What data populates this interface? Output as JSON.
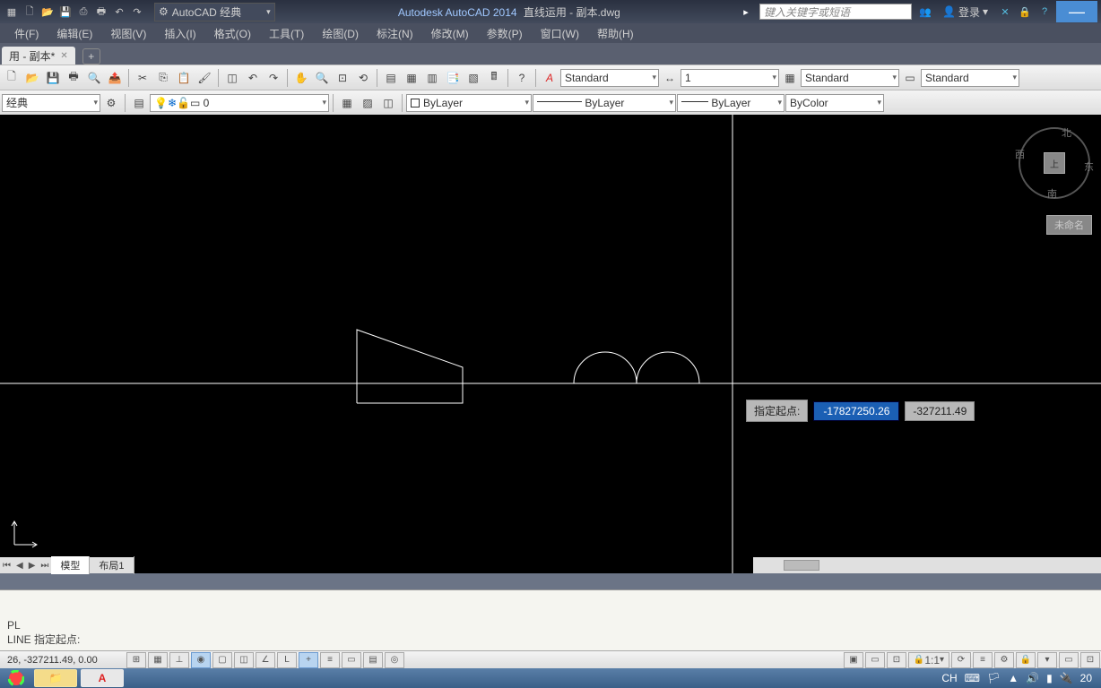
{
  "titlebar": {
    "workspace": "AutoCAD 经典",
    "app": "Autodesk AutoCAD 2014",
    "doc": "直线运用 - 副本.dwg",
    "search_placeholder": "键入关键字或短语",
    "login": "登录"
  },
  "menu": [
    "件(F)",
    "编辑(E)",
    "视图(V)",
    "插入(I)",
    "格式(O)",
    "工具(T)",
    "绘图(D)",
    "标注(N)",
    "修改(M)",
    "参数(P)",
    "窗口(W)",
    "帮助(H)"
  ],
  "filetab": {
    "name": "用 - 副本*"
  },
  "toolbar2": {
    "workspace": "经典",
    "layer_current": "0"
  },
  "styles": {
    "text_style": "Standard",
    "dim_style": "Standard",
    "table_style": "Standard",
    "lineweight": "1"
  },
  "layerprops": {
    "color": "ByLayer",
    "linetype": "ByLayer",
    "lineweight": "ByLayer",
    "plotstyle": "ByColor"
  },
  "viewcube": {
    "top": "上",
    "n": "北",
    "s": "南",
    "e": "东",
    "w": "西",
    "state": "未命名"
  },
  "dynamic_input": {
    "label": "指定起点:",
    "value1": "-17827250.26",
    "value2": "-327211.49"
  },
  "layout_tabs": [
    "模型",
    "布局1"
  ],
  "command": {
    "hist1": "PL",
    "line": "LINE 指定起点:"
  },
  "status": {
    "coords": "26, -327211.49, 0.00",
    "scale": "1:1"
  },
  "taskbar": {
    "ime": "CH",
    "time": "20"
  }
}
